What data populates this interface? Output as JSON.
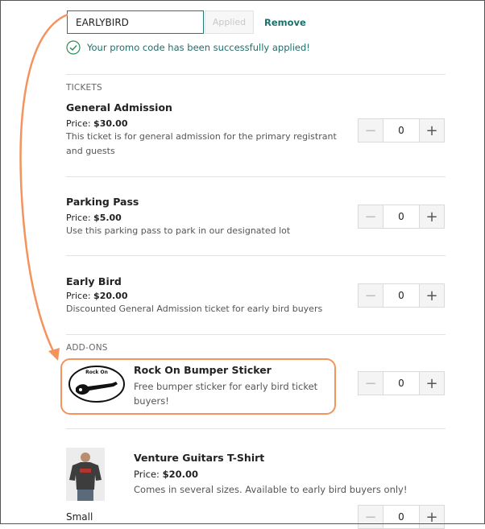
{
  "promo": {
    "code_value": "EARLYBIRD",
    "applied_label": "Applied",
    "remove_label": "Remove",
    "success_message": "Your promo code has been successfully applied!"
  },
  "sections": {
    "tickets_label": "TICKETS",
    "addons_label": "ADD-ONS"
  },
  "tickets": [
    {
      "name": "General Admission",
      "price_label": "Price:",
      "price": "$30.00",
      "description": "This ticket is for general admission for the primary registrant and guests",
      "quantity": "0"
    },
    {
      "name": "Parking Pass",
      "price_label": "Price:",
      "price": "$5.00",
      "description": "Use this parking pass to park in our designated lot",
      "quantity": "0"
    },
    {
      "name": "Early Bird",
      "price_label": "Price:",
      "price": "$20.00",
      "description": "Discounted General Admission ticket for early bird buyers",
      "quantity": "0"
    }
  ],
  "addons": [
    {
      "name": "Rock On Bumper Sticker",
      "description": "Free bumper sticker for early bird ticket buyers!",
      "image_text": "Rock On",
      "quantity": "0"
    },
    {
      "name": "Venture Guitars T-Shirt",
      "price_label": "Price:",
      "price": "$20.00",
      "description": "Comes in several sizes. Available to early bird buyers only!",
      "size_label": "Small",
      "quantity": "0"
    }
  ],
  "stepper": {
    "minus": "−",
    "plus": "+"
  },
  "colors": {
    "accent": "#1f6f6c",
    "highlight": "#f4935c"
  }
}
